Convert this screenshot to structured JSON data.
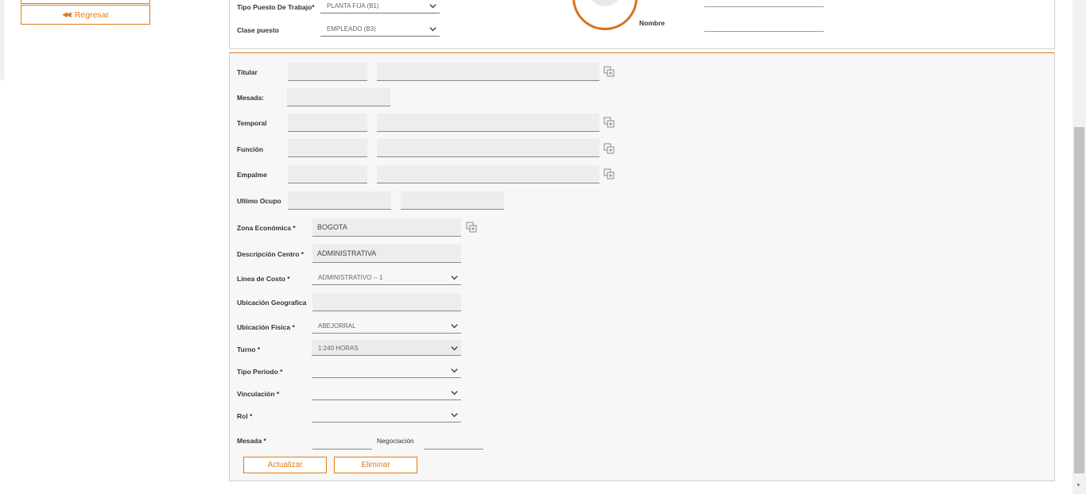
{
  "sidebar": {
    "back_button_label": "Regresar"
  },
  "header_panel": {
    "tipo_puesto_label": "Tipo Puesto De Trabajo*",
    "tipo_puesto_value": "PLANTA FIJA (B1)",
    "clase_puesto_label": "Clase puesto",
    "clase_puesto_value": "EMPLEADO (B3)",
    "nombre_label": "Nombre"
  },
  "form": {
    "titular_label": "Titular",
    "mesada_top_label": "Mesada:",
    "temporal_label": "Temporal",
    "funcion_label": "Función",
    "empalme_label": "Empalme",
    "ultimo_ocupo_label": "Ultimo Ocupo",
    "zona_label": "Zona Económica *",
    "zona_value": "BOGOTA",
    "desc_centro_label": "Descripción Centro *",
    "desc_centro_value": "ADMINISTRATIVA",
    "linea_costo_label": "Linea de Costo *",
    "linea_costo_value": "ADMINISTRATIVO -- 1",
    "ubic_geo_label": "Ubicación Geografica",
    "ubic_fisica_label": "Ubicación Fisica *",
    "ubic_fisica_value": "ABEJORRAL",
    "turno_label": "Turno *",
    "turno_value": "1:240 HORAS",
    "tipo_periodo_label": "Tipo Periodo *",
    "vinculacion_label": "Vinculación *",
    "rol_label": "Rol *",
    "mesada_label": "Mesada *",
    "negociacion_label": "Negociación",
    "actualizar_label": "Actualizar",
    "eliminar_label": "Eliminar"
  },
  "colors": {
    "accent": "#e07b1a",
    "panel_bg": "#f7f7f7",
    "field_bg": "#ededed"
  },
  "icons": [
    "rewind-icon",
    "chevron-down-icon",
    "copy-icon"
  ]
}
